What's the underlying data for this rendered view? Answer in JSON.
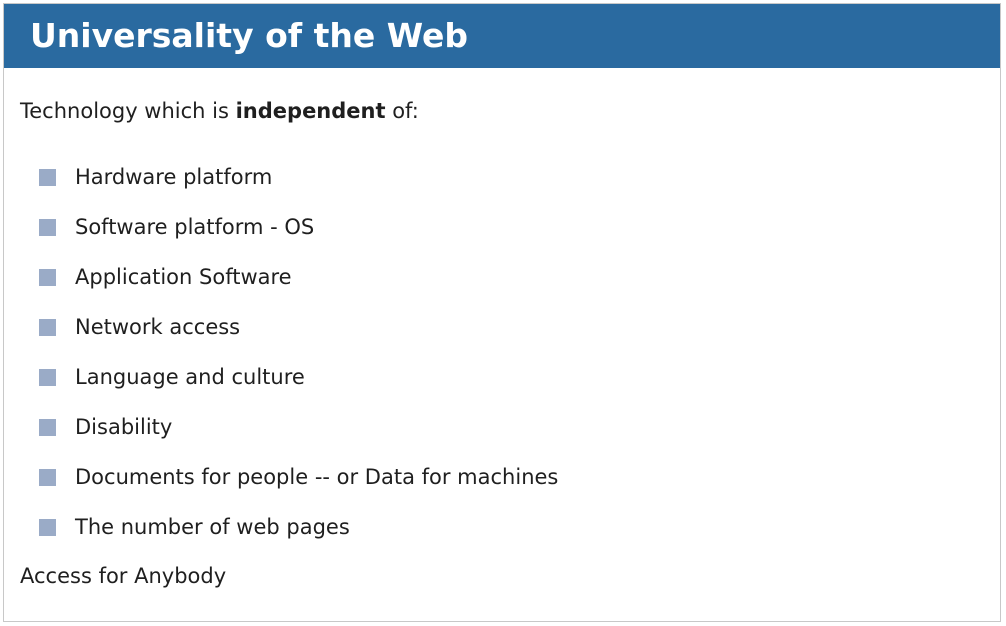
{
  "slide": {
    "title": "Universality of the Web",
    "intro": {
      "before": "Technology which is ",
      "emphasis": "independent",
      "after": " of:"
    },
    "bullets": [
      "Hardware platform",
      "Software platform - OS",
      "Application Software",
      "Network access",
      "Language and culture",
      "Disability",
      "Documents for people -- or Data for machines",
      "The number of web pages"
    ],
    "closing": "Access for Anybody"
  },
  "colors": {
    "title_bar": "#2a6aa0",
    "title_text": "#ffffff",
    "bullet_square": "#9aabc7",
    "body_text": "#1f1f1f"
  }
}
